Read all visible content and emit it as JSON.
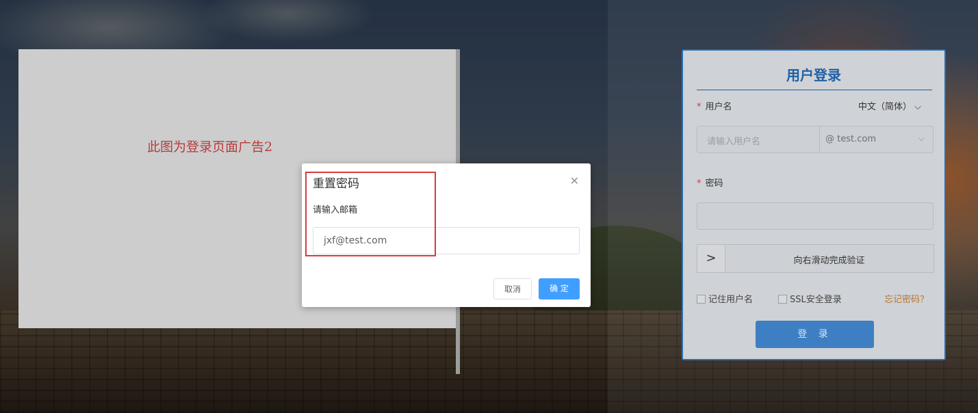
{
  "ad": {
    "text": "此图为登录页面广告2"
  },
  "login": {
    "title": "用户登录",
    "username_label": "用户名",
    "required_mark": "*",
    "language": "中文（简体）",
    "username_placeholder": "请输入用户名",
    "domain_value": "@ test.com",
    "password_label": "密码",
    "slider_text": "向右滑动完成验证",
    "remember_label": "记住用户名",
    "ssl_label": "SSL安全登录",
    "forgot_label": "忘记密码？",
    "login_button": "登 录"
  },
  "modal": {
    "title": "重置密码",
    "email_label": "请输入邮箱",
    "email_value": "jxf@test.com",
    "cancel": "取消",
    "confirm": "确 定"
  },
  "colors": {
    "accent": "#409eff",
    "brand": "#1f5fa5",
    "highlight": "#d63b3b"
  }
}
